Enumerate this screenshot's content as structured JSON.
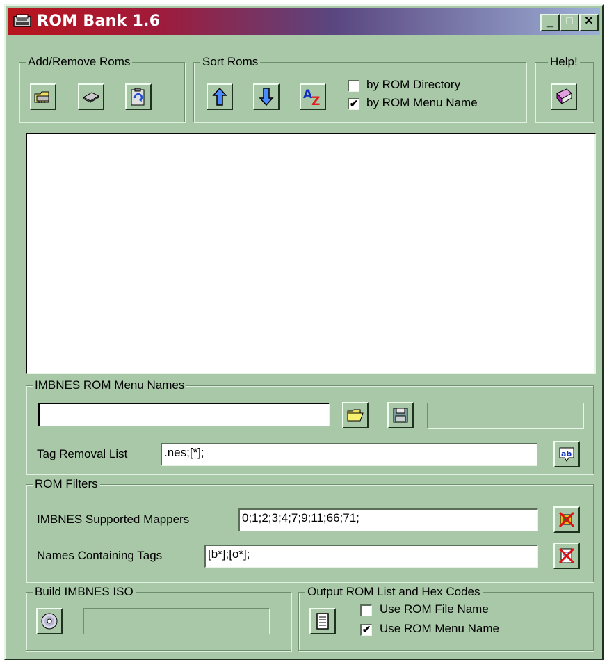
{
  "window": {
    "title": "ROM Bank 1.6",
    "controls": {
      "minimize": "_",
      "maximize": "□",
      "close": "✕"
    }
  },
  "add_remove": {
    "legend": "Add/Remove Roms",
    "buttons": [
      {
        "name": "add-rom-folder-button",
        "icon": "folder-chip-icon"
      },
      {
        "name": "add-rom-chip-button",
        "icon": "chip-icon"
      },
      {
        "name": "remove-roms-button",
        "icon": "clipboard-refresh-icon"
      }
    ]
  },
  "sort": {
    "legend": "Sort Roms",
    "by_directory": {
      "label": "by ROM Directory",
      "checked": false
    },
    "by_menu_name": {
      "label": "by ROM Menu Name",
      "checked": true
    },
    "checkmark": "✔"
  },
  "help": {
    "legend": "Help!",
    "icon": "help-book-icon"
  },
  "menu_names": {
    "legend": "IMBNES ROM Menu Names",
    "path_value": "",
    "status_value": "",
    "tag_removal_label": "Tag Removal List",
    "tag_removal_value": ".nes;[*];"
  },
  "filters": {
    "legend": "ROM Filters",
    "mappers_label": "IMBNES Supported Mappers",
    "mappers_value": "0;1;2;3;4;7;9;11;66;71;",
    "tags_label": "Names Containing Tags",
    "tags_value": "[b*];[o*];"
  },
  "build_iso": {
    "legend": "Build IMBNES ISO",
    "status_value": ""
  },
  "output": {
    "legend": "Output ROM List and Hex Codes",
    "use_file_name": {
      "label": "Use ROM File Name",
      "checked": false
    },
    "use_menu_name": {
      "label": "Use ROM Menu Name",
      "checked": true
    },
    "checkmark": "✔"
  },
  "colors": {
    "face": "#a8c8a8",
    "title_left": "#b8141c",
    "title_right": "#9cb0d6"
  }
}
